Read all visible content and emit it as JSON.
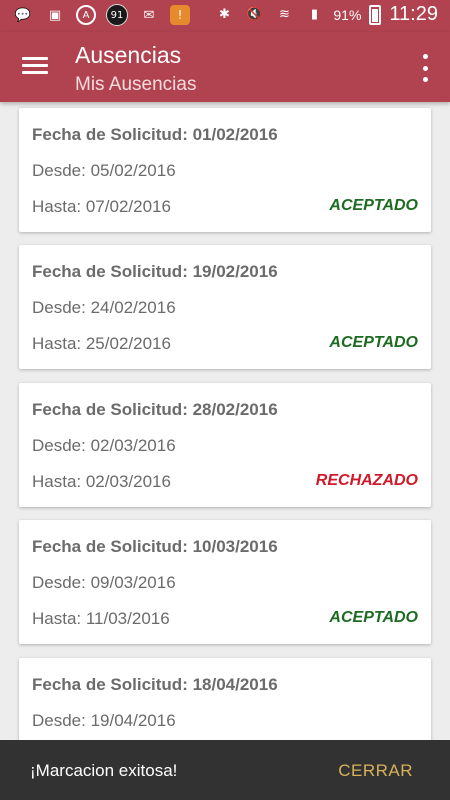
{
  "status_bar": {
    "left_icons": [
      {
        "icon": "chat-bubble-icon",
        "glyph": "💬"
      },
      {
        "icon": "sim-card-icon",
        "glyph": "▣"
      },
      {
        "icon": "app-circle-icon",
        "glyph": "A"
      },
      {
        "icon": "notification-badge-icon",
        "glyph": "91"
      },
      {
        "icon": "mail-icon",
        "glyph": "✉"
      },
      {
        "icon": "app-alert-icon",
        "glyph": "!"
      }
    ],
    "battery": "91%",
    "time": "11:29"
  },
  "appbar": {
    "title": "Ausencias",
    "subtitle": "Mis Ausencias",
    "color": "#b0434f"
  },
  "absences": [
    {
      "fecha": "Fecha de Solicitud: 01/02/2016",
      "desde": "Desde: 05/02/2016",
      "hasta": "Hasta: 07/02/2016",
      "estado": "ACEPTADO",
      "estado_color": "#1d6b22"
    },
    {
      "fecha": "Fecha de Solicitud: 19/02/2016",
      "desde": "Desde: 24/02/2016",
      "hasta": "Hasta: 25/02/2016",
      "estado": "ACEPTADO",
      "estado_color": "#1d6b22"
    },
    {
      "fecha": "Fecha de Solicitud: 28/02/2016",
      "desde": "Desde: 02/03/2016",
      "hasta": "Hasta: 02/03/2016",
      "estado": "RECHAZADO",
      "estado_color": "#d0192a"
    },
    {
      "fecha": "Fecha de Solicitud: 10/03/2016",
      "desde": "Desde: 09/03/2016",
      "hasta": "Hasta: 11/03/2016",
      "estado": "ACEPTADO",
      "estado_color": "#1d6b22"
    },
    {
      "fecha": "Fecha de Solicitud: 18/04/2016",
      "desde": "Desde: 19/04/2016",
      "hasta": "",
      "estado": "",
      "estado_color": "#1d6b22"
    }
  ],
  "snackbar": {
    "message": "¡Marcacion exitosa!",
    "action": "CERRAR"
  }
}
